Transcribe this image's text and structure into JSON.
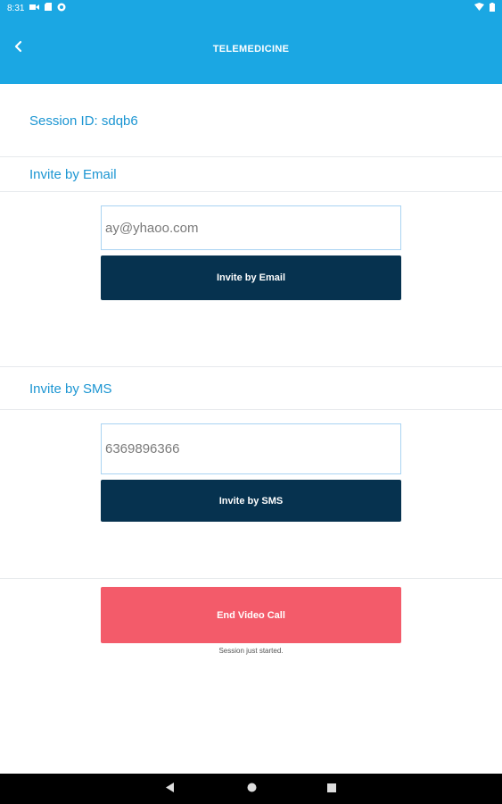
{
  "status_bar": {
    "time": "8:31",
    "icons": [
      "video-call-icon",
      "sd-card-icon",
      "app-notification-icon",
      "wifi-icon",
      "battery-icon"
    ]
  },
  "header": {
    "title": "TELEMEDICINE",
    "back_icon": "chevron-left-icon"
  },
  "session": {
    "id_label": "Session ID: sdqb6",
    "status": "Session just started."
  },
  "email_section": {
    "heading": "Invite by Email",
    "input_value": "ay@yhaoo.com",
    "button_label": "Invite by Email"
  },
  "sms_section": {
    "heading": "Invite by SMS",
    "input_value": "6369896366",
    "button_label": "Invite by SMS"
  },
  "end_call": {
    "button_label": "End Video Call"
  },
  "navigation": {
    "icons": [
      "back-triangle-icon",
      "home-circle-icon",
      "recents-square-icon"
    ]
  },
  "colors": {
    "primary": "#1ba7e3",
    "section_text": "#1b95d2",
    "dark_button": "#06324f",
    "end_button": "#f35b6a"
  }
}
